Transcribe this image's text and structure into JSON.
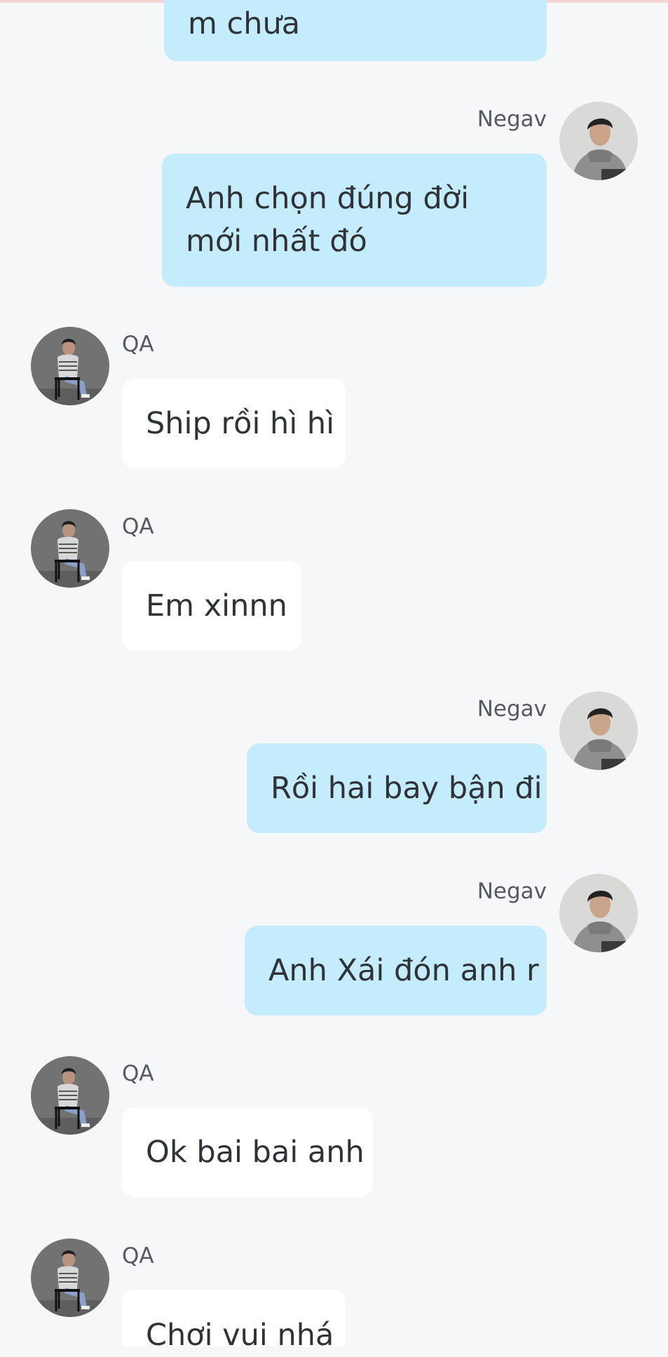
{
  "messages": [
    {
      "sender": "",
      "direction": "out",
      "text": "m chưa"
    },
    {
      "sender": "Negav",
      "direction": "out",
      "text": "Anh chọn đúng đời mới nhất đó"
    },
    {
      "sender": "QA",
      "direction": "in",
      "text": "Ship rồi hì hì"
    },
    {
      "sender": "QA",
      "direction": "in",
      "text": "Em xinnn"
    },
    {
      "sender": "Negav",
      "direction": "out",
      "text": "Rồi hai bay bận đi"
    },
    {
      "sender": "Negav",
      "direction": "out",
      "text": "Anh Xái đón anh r"
    },
    {
      "sender": "QA",
      "direction": "in",
      "text": "Ok bai bai anh"
    },
    {
      "sender": "QA",
      "direction": "in",
      "text": "Chơi vui nhá"
    }
  ],
  "colors": {
    "background": "#f6f7f9",
    "outgoing_bubble": "#c5ecfd",
    "incoming_bubble": "#ffffff",
    "text": "#2f3237",
    "name": "#555a61"
  },
  "icons": {
    "negav_avatar": "negav-avatar-icon",
    "qa_avatar": "qa-avatar-icon"
  }
}
